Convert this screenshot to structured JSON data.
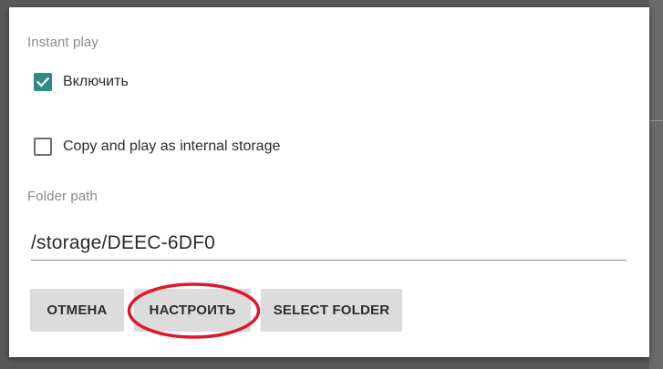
{
  "dialog": {
    "instant_play_label": "Instant play",
    "enable": {
      "label": "Включить",
      "checked": true
    },
    "copy_internal": {
      "label": "Copy and play as internal storage",
      "checked": false
    },
    "folder_path_label": "Folder path",
    "folder_path_value": "/storage/DEEC-6DF0"
  },
  "buttons": {
    "cancel_label": "ОТМЕНА",
    "setup_label": "НАСТРОИТЬ",
    "select_folder_label": "SELECT FOLDER"
  },
  "colors": {
    "checkbox_checked": "#2e8b84",
    "button_bg": "#dcdcdc",
    "annotation_red": "#e0162b"
  },
  "icons": {
    "checked": "check-icon",
    "annotation": "red-ellipse-annotation"
  }
}
